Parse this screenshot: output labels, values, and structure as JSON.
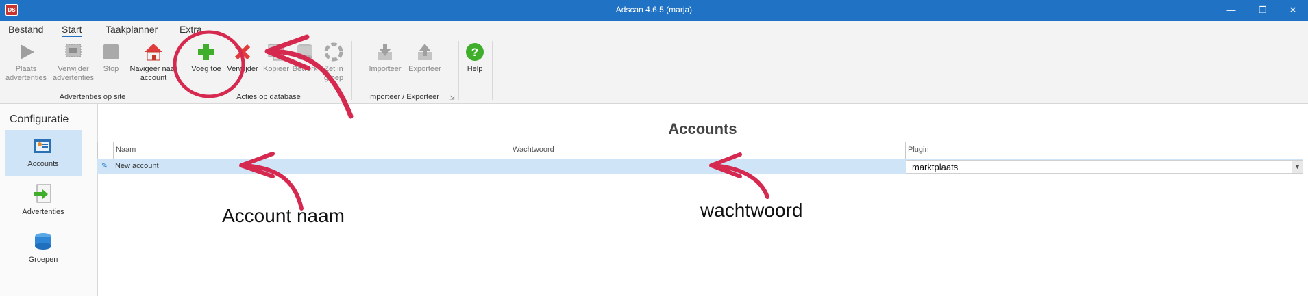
{
  "window": {
    "title": "Adscan 4.6.5 (marja)",
    "app_icon": "adscan-logo-icon",
    "controls": [
      "minimize-icon",
      "restore-icon",
      "close-icon"
    ]
  },
  "ribbon_tabs": [
    {
      "label": "Bestand"
    },
    {
      "label": "Start",
      "active": true
    },
    {
      "label": "Taakplanner"
    },
    {
      "label": "Extra"
    }
  ],
  "ribbon": {
    "groups": [
      {
        "label": "Advertenties op site"
      },
      {
        "label": "Acties op database"
      },
      {
        "label": "Importeer / Exporteer"
      }
    ],
    "buttons": {
      "plaats": {
        "label": "Plaats advertenties",
        "icon": "play-icon",
        "enabled": false
      },
      "verwijder_adv": {
        "label": "Verwijder advertenties",
        "icon": "remove-ads-icon",
        "enabled": false
      },
      "stop": {
        "label": "Stop",
        "icon": "stop-icon",
        "enabled": false
      },
      "navigeer": {
        "label": "Navigeer naar account",
        "icon": "home-icon",
        "enabled": true
      },
      "voeg_toe": {
        "label": "Voeg toe",
        "icon": "plus-icon",
        "enabled": true
      },
      "verwijder": {
        "label": "Verwijder",
        "icon": "delete-x-icon",
        "enabled": true
      },
      "kopieer": {
        "label": "Kopieer",
        "icon": "copy-icon",
        "enabled": false
      },
      "bewerk": {
        "label": "Bewerk",
        "icon": "database-icon",
        "enabled": false
      },
      "zet_in_groep": {
        "label": "Zet in groep",
        "icon": "group-icon",
        "enabled": false
      },
      "importeer": {
        "label": "Importeer",
        "icon": "import-icon",
        "enabled": false
      },
      "exporteer": {
        "label": "Exporteer",
        "icon": "export-icon",
        "enabled": false
      },
      "help": {
        "label": "Help",
        "icon": "help-icon",
        "enabled": true
      }
    }
  },
  "sidebar": {
    "title": "Configuratie",
    "items": [
      {
        "label": "Accounts",
        "icon": "accounts-icon",
        "active": true
      },
      {
        "label": "Advertenties",
        "icon": "advertisements-icon"
      },
      {
        "label": "Groepen",
        "icon": "groups-icon"
      }
    ]
  },
  "main": {
    "title": "Accounts",
    "columns": [
      "Naam",
      "Wachtwoord",
      "Plugin"
    ],
    "rows": [
      {
        "naam": "New account",
        "wachtwoord": "",
        "plugin": "marktplaats"
      }
    ]
  },
  "annotations": {
    "account_label": "Account naam",
    "password_label": "wachtwoord"
  },
  "colors": {
    "titlebar": "#1f72c4",
    "selection": "#cfe5f7",
    "annotation": "#d6294f"
  }
}
